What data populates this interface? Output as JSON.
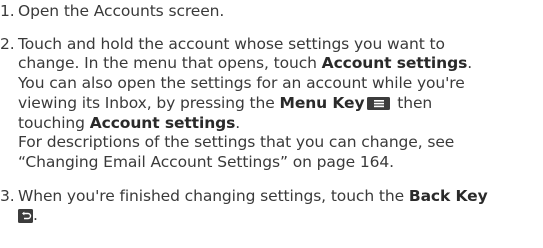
{
  "steps": [
    {
      "number": "1.",
      "text": "Open the Accounts screen."
    },
    {
      "number": "2.",
      "line1": "Touch and hold the account whose settings you want to",
      "line2_a": "change. In the menu that opens, touch ",
      "line2_b": "Account settings",
      "line2_c": ".",
      "line3": "You can also open the settings for an account while you're",
      "line4_a": "viewing its Inbox, by pressing the ",
      "line4_b": "Menu Key",
      "line4_c": " then",
      "line5_a": "touching ",
      "line5_b": "Account settings",
      "line5_c": ".",
      "line6": "For descriptions of the settings that you can change, see",
      "line7": "“Changing Email Account Settings” on page 164."
    },
    {
      "number": "3.",
      "line1_a": "When you're finished changing settings, touch the ",
      "line1_b": "Back Key",
      "line2_c": "."
    }
  ],
  "icons": {
    "menu_key": "menu-key-icon",
    "back_key": "back-key-icon"
  },
  "colors": {
    "text": "#3a3a3a",
    "icon_fill": "#3c3c3c"
  }
}
